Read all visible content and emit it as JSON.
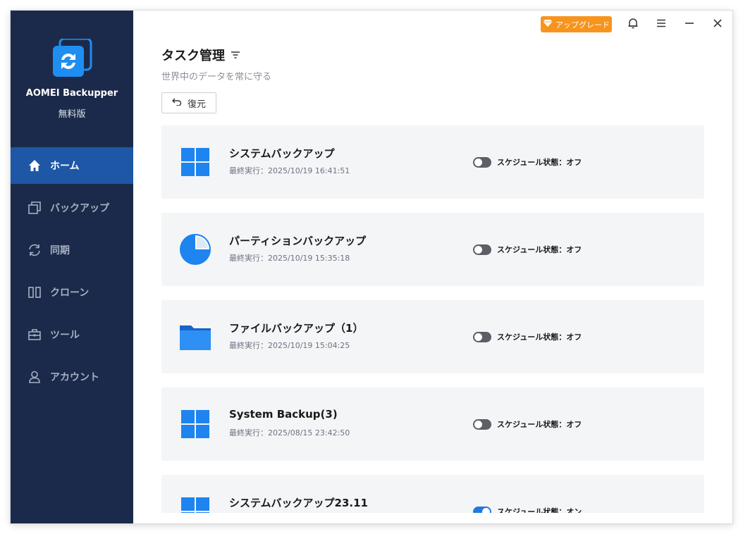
{
  "app": {
    "name": "AOMEI Backupper",
    "edition": "無料版",
    "upgrade_label": "アップグレード"
  },
  "sidebar": {
    "items": [
      {
        "label": "ホーム",
        "icon": "home-icon",
        "active": true
      },
      {
        "label": "バックアップ",
        "icon": "backup-icon",
        "active": false
      },
      {
        "label": "同期",
        "icon": "sync-icon",
        "active": false
      },
      {
        "label": "クローン",
        "icon": "clone-icon",
        "active": false
      },
      {
        "label": "ツール",
        "icon": "tools-icon",
        "active": false
      },
      {
        "label": "アカウント",
        "icon": "account-icon",
        "active": false
      }
    ]
  },
  "main": {
    "title": "タスク管理",
    "subtitle": "世界中のデータを常に守る",
    "restore_label": "復元",
    "tasks": [
      {
        "name": "システムバックアップ",
        "last_run": "最終実行：2025/10/19 16:41:51",
        "schedule": "スケジュール状態：オフ",
        "schedule_on": false,
        "icon": "windows-icon"
      },
      {
        "name": "パーティションバックアップ",
        "last_run": "最終実行：2025/10/19 15:35:18",
        "schedule": "スケジュール状態：オフ",
        "schedule_on": false,
        "icon": "partition-pie-icon"
      },
      {
        "name": "ファイルバックアップ（1）",
        "last_run": "最終実行：2025/10/19 15:04:25",
        "schedule": "スケジュール状態：オフ",
        "schedule_on": false,
        "icon": "folder-icon"
      },
      {
        "name": "System Backup(3)",
        "last_run": "最終実行：2025/08/15 23:42:50",
        "schedule": "スケジュール状態：オフ",
        "schedule_on": false,
        "icon": "windows-icon"
      },
      {
        "name": "システムバックアップ23.11",
        "last_run": "",
        "schedule": "スケジュール状態：オン",
        "schedule_on": true,
        "icon": "windows-icon"
      }
    ]
  },
  "colors": {
    "sidebar_bg": "#1b2a4a",
    "active_nav": "#1d57a6",
    "upgrade": "#f7941d",
    "accent_blue": "#1f7ae0"
  }
}
